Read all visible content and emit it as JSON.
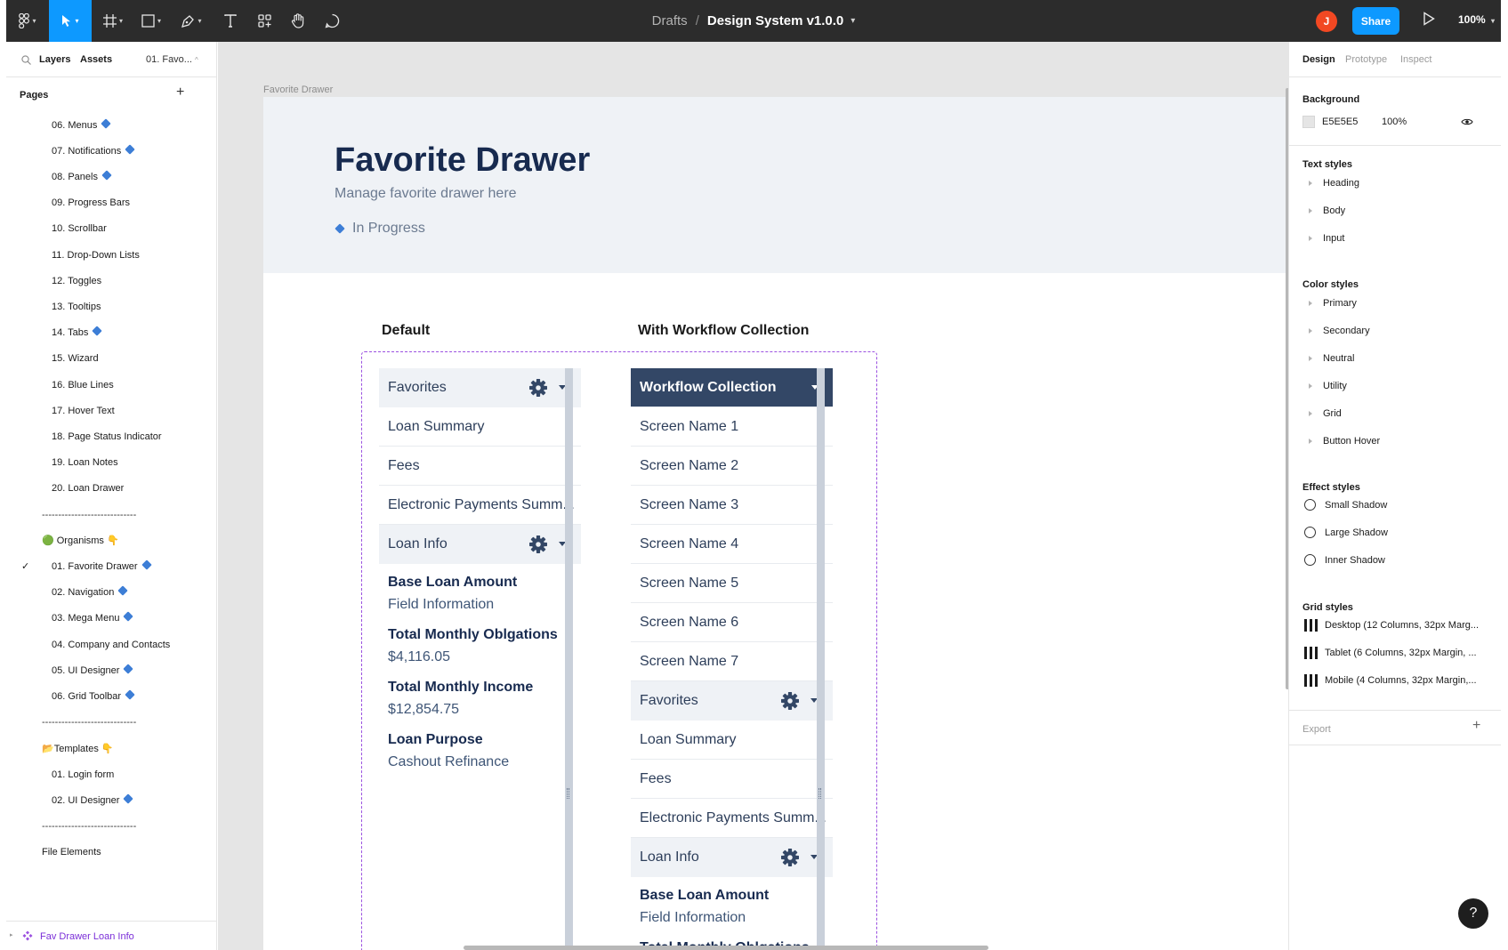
{
  "toolbar": {
    "breadcrumb": "Drafts",
    "separator": "/",
    "document_title": "Design System v1.0.0",
    "avatar_initial": "J",
    "share_label": "Share",
    "zoom": "100%"
  },
  "left_panel": {
    "tabs": {
      "layers": "Layers",
      "assets": "Assets",
      "current_page": "01. Favo..."
    },
    "pages_heading": "Pages",
    "pages": [
      {
        "label": "06.  Menus",
        "diamond": true
      },
      {
        "label": "07.  Notifications",
        "diamond": true
      },
      {
        "label": "08.  Panels",
        "diamond": true
      },
      {
        "label": "09.  Progress Bars",
        "diamond": false
      },
      {
        "label": "10.  Scrollbar",
        "diamond": false
      },
      {
        "label": "11.  Drop-Down Lists",
        "diamond": false
      },
      {
        "label": "12.  Toggles",
        "diamond": false
      },
      {
        "label": "13.  Tooltips",
        "diamond": false
      },
      {
        "label": "14.  Tabs",
        "diamond": true
      },
      {
        "label": "15.  Wizard",
        "diamond": false
      },
      {
        "label": "16.  Blue Lines",
        "diamond": false
      },
      {
        "label": "17.  Hover Text",
        "diamond": false
      },
      {
        "label": "18.  Page Status Indicator",
        "diamond": false
      },
      {
        "label": "19.  Loan Notes",
        "diamond": false
      },
      {
        "label": "20.  Loan Drawer",
        "diamond": false
      },
      {
        "label": "-----------------------------",
        "kind": "sep"
      },
      {
        "label": "🟢 Organisms 👇",
        "kind": "group"
      },
      {
        "label": "01.  Favorite Drawer",
        "diamond": true,
        "selected": true
      },
      {
        "label": "02.  Navigation",
        "diamond": true
      },
      {
        "label": "03.  Mega Menu",
        "diamond": true
      },
      {
        "label": "04.  Company and Contacts",
        "diamond": false
      },
      {
        "label": "05.  UI Designer",
        "diamond": true
      },
      {
        "label": "06.  Grid Toolbar",
        "diamond": true
      },
      {
        "label": "-----------------------------",
        "kind": "sep"
      },
      {
        "label": "📂Templates 👇",
        "kind": "group"
      },
      {
        "label": "01.  Login form",
        "diamond": false
      },
      {
        "label": "02.  UI Designer",
        "diamond": true
      },
      {
        "label": "-----------------------------",
        "kind": "sep"
      },
      {
        "label": "File Elements",
        "kind": "plain"
      }
    ],
    "selected_layer": "Fav Drawer Loan Info"
  },
  "canvas": {
    "frame_label": "Favorite Drawer",
    "title": "Favorite Drawer",
    "subtitle": "Manage favorite drawer here",
    "status": "In Progress",
    "col_default": "Default",
    "col_workflow": "With Workflow Collection",
    "default_drawer": {
      "rows": [
        {
          "label": "Favorites",
          "kind": "hdr"
        },
        {
          "label": "Loan Summary"
        },
        {
          "label": "Fees"
        },
        {
          "label": "Electronic Payments Summ..."
        },
        {
          "label": "Loan Info",
          "kind": "hdr"
        }
      ],
      "fields": [
        {
          "label": "Base Loan Amount",
          "value": "Field Information"
        },
        {
          "label": "Total Monthly Oblgations",
          "value": "$4,116.05"
        },
        {
          "label": "Total Monthly Income",
          "value": "$12,854.75"
        },
        {
          "label": "Loan Purpose",
          "value": "Cashout Refinance"
        }
      ]
    },
    "workflow_drawer": {
      "rows": [
        {
          "label": "Workflow Collection",
          "kind": "dark"
        },
        {
          "label": "Screen Name 1"
        },
        {
          "label": "Screen Name 2"
        },
        {
          "label": "Screen Name 3"
        },
        {
          "label": "Screen Name 4"
        },
        {
          "label": "Screen Name 5"
        },
        {
          "label": "Screen Name 6"
        },
        {
          "label": "Screen Name 7"
        },
        {
          "label": "Favorites",
          "kind": "hdr"
        },
        {
          "label": "Loan Summary"
        },
        {
          "label": "Fees"
        },
        {
          "label": "Electronic Payments Summ..."
        },
        {
          "label": "Loan Info",
          "kind": "hdr"
        }
      ],
      "fields": [
        {
          "label": "Base Loan Amount",
          "value": "Field Information"
        },
        {
          "label": "Total Monthly Oblgations",
          "value": ""
        }
      ]
    }
  },
  "right_panel": {
    "tabs": {
      "design": "Design",
      "prototype": "Prototype",
      "inspect": "Inspect"
    },
    "background": {
      "heading": "Background",
      "hex": "E5E5E5",
      "opacity": "100%",
      "swatch": "#e5e5e5"
    },
    "text_styles": {
      "heading": "Text styles",
      "items": [
        "Heading",
        "Body",
        "Input"
      ]
    },
    "color_styles": {
      "heading": "Color styles",
      "items": [
        "Primary",
        "Secondary",
        "Neutral",
        "Utility",
        "Grid",
        "Button Hover"
      ]
    },
    "effect_styles": {
      "heading": "Effect styles",
      "items": [
        "Small Shadow",
        "Large Shadow",
        "Inner Shadow"
      ]
    },
    "grid_styles": {
      "heading": "Grid styles",
      "items": [
        "Desktop (12 Columns, 32px Marg...",
        "Tablet (6 Columns, 32px Margin, ...",
        "Mobile (4 Columns, 32px Margin,..."
      ]
    },
    "export": "Export"
  },
  "help_label": "?",
  "colors": {
    "accent": "#0d99ff",
    "drawer_dark": "#334766",
    "selection": "#9b51e0"
  }
}
